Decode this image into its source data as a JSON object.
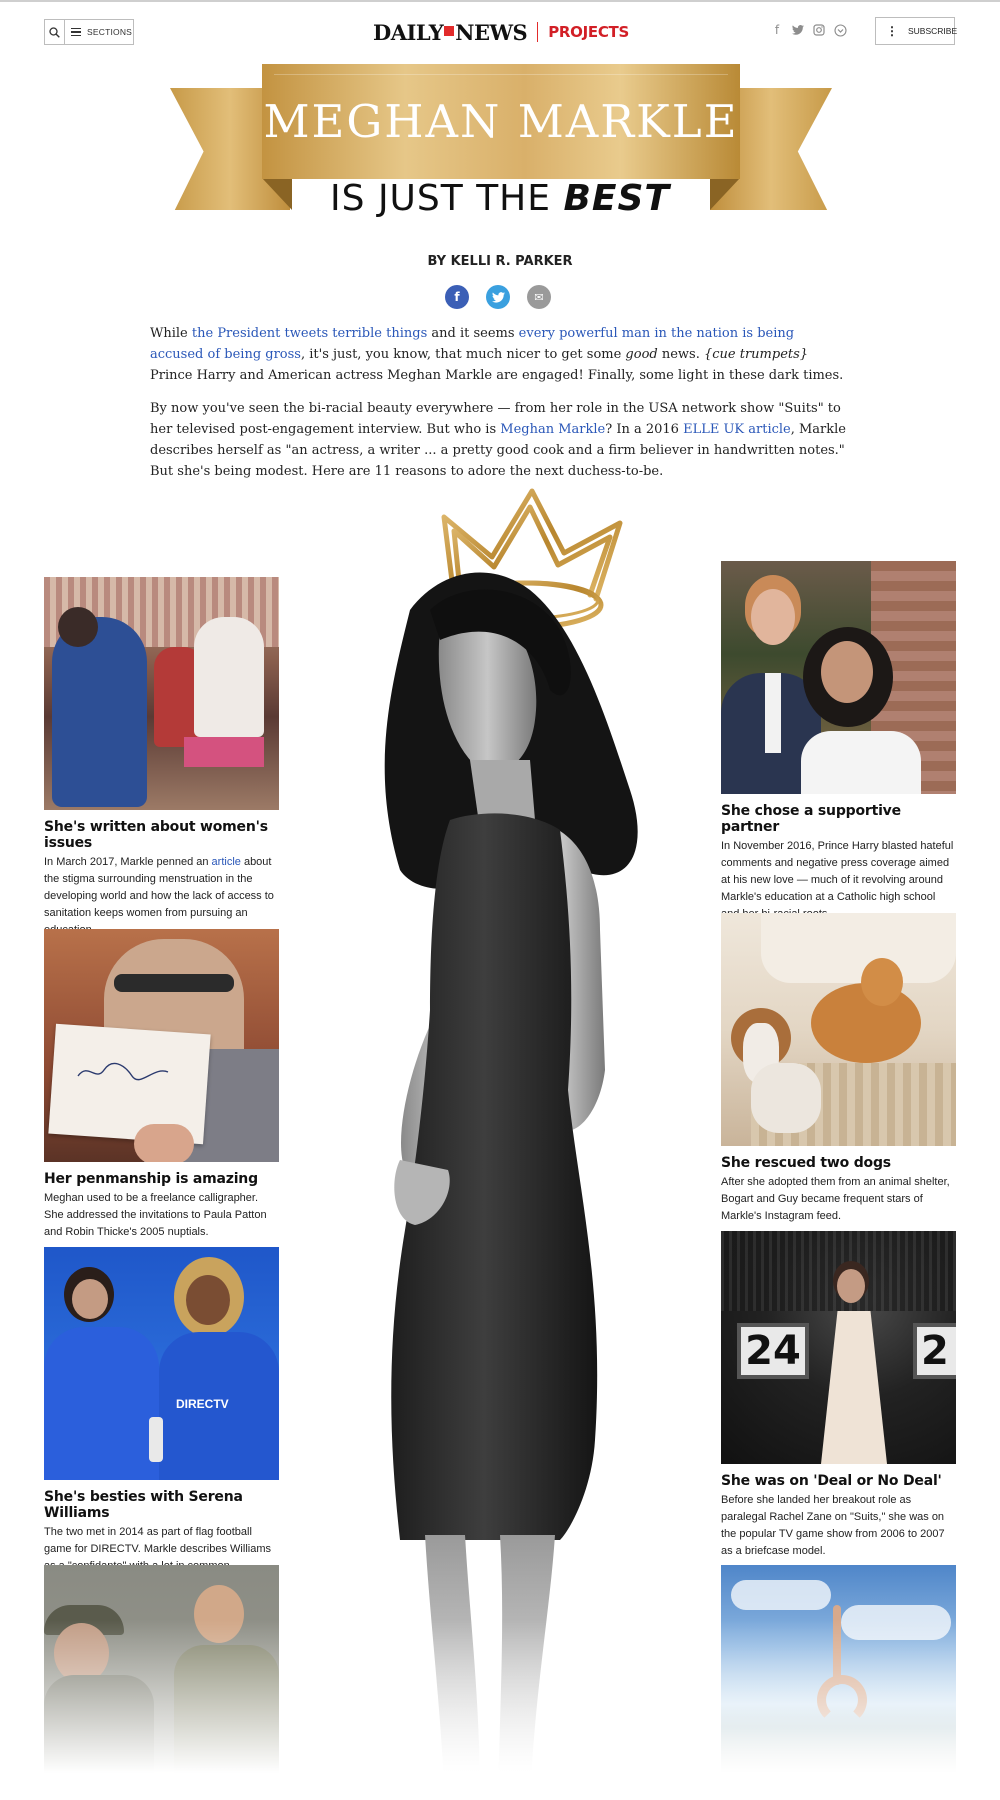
{
  "header": {
    "sections_label": "SECTIONS",
    "brand_daily": "DAILY",
    "brand_news": "NEWS",
    "brand_projects": "PROJECTS",
    "subscribe_label": "SUBSCRIBE",
    "social_icons": [
      "facebook-icon",
      "twitter-icon",
      "instagram-icon",
      "chevron-down-icon"
    ]
  },
  "banner": {
    "title": "MEGHAN MARKLE",
    "subtitle_prefix": "IS JUST THE ",
    "subtitle_emphasis": "BEST",
    "ribbon_color": "#d9b06a"
  },
  "byline": "BY KELLI R. PARKER",
  "share": {
    "facebook": "f",
    "twitter": "t",
    "email": "✉"
  },
  "intro": {
    "p1_a": "While ",
    "p1_link1": "the President tweets terrible things",
    "p1_b": " and it seems ",
    "p1_link2": "every powerful man in the nation is being accused of being gross",
    "p1_c": ", it's just, you know, that much nicer to get some ",
    "p1_em": "good",
    "p1_d": " news. ",
    "p1_em2": "{cue trumpets}",
    "p1_e": " Prince Harry and American actress Meghan Markle are engaged! Finally, some light in these dark times.",
    "p2_a": "By now you've seen the bi-racial beauty everywhere — from her role in the USA network show \"Suits\" to her televised post-engagement interview. But who is ",
    "p2_link1": "Meghan Markle",
    "p2_b": "? In a 2016 ",
    "p2_link2": "ELLE UK article",
    "p2_c": ", Markle describes herself as \"an actress, a writer ... a pretty good cook and a firm believer in handwritten notes.\" But she's being modest. Here are 11 reasons to adore the next duchess-to-be."
  },
  "cards_left": [
    {
      "title": "She's written about women's issues",
      "text_a": "In March 2017, Markle penned an ",
      "link": "article",
      "text_b": " about the stigma surrounding menstruation in the developing world and how the lack of access to sanitation keeps women from pursuing an education."
    },
    {
      "title": "Her penmanship is amazing",
      "text_a": "Meghan used to be a freelance calligrapher. She addressed the invitations to Paula Patton and Robin Thicke's 2005 nuptials."
    },
    {
      "title": "She's besties with Serena Williams",
      "text_a": "The two met in 2014 as part of flag football game for DIRECTV. Markle describes Williams as a \"confidante\" with a lot in common.",
      "jersey": "DIRECTV"
    },
    {
      "title": ""
    }
  ],
  "cards_right": [
    {
      "title": "She chose a supportive partner",
      "text_a": "In November 2016, Prince Harry blasted hateful comments and negative press coverage aimed at his new love — much of it revolving around Markle's education at a Catholic high school and her bi-racial roots."
    },
    {
      "title": "She rescued two dogs",
      "text_a": "After she adopted them from an animal shelter, Bogart and Guy became frequent stars of Markle's Instagram feed."
    },
    {
      "title": "She was on 'Deal or No Deal'",
      "text_a": "Before she landed her breakout role as paralegal Rachel Zane on \"Suits,\" she was on the popular TV game show from 2006 to 2007 as a briefcase model.",
      "case_numbers": [
        "24",
        "2"
      ]
    },
    {
      "title": ""
    }
  ]
}
